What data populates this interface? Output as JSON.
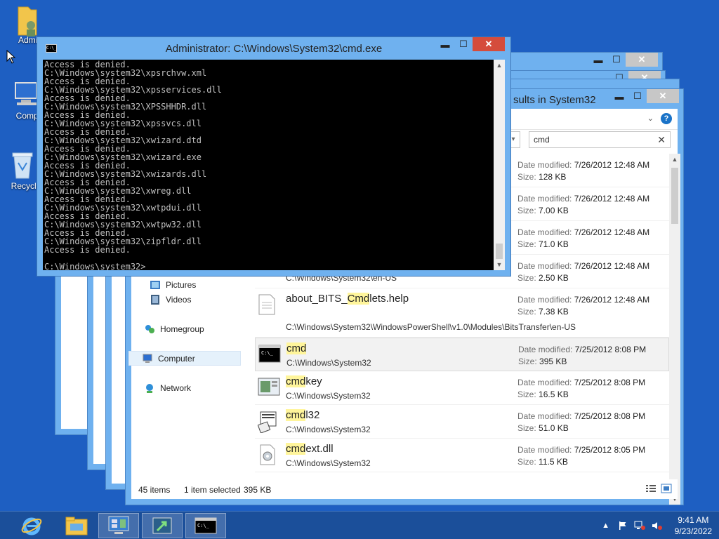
{
  "desktop": {
    "icons": [
      {
        "label": "Admin"
      },
      {
        "label": "Compu"
      },
      {
        "label": "Recycle"
      }
    ]
  },
  "cmd": {
    "title": "Administrator: C:\\Windows\\System32\\cmd.exe",
    "icon_text": "C:\\_",
    "lines": [
      "Access is denied.",
      "C:\\Windows\\system32\\xpsrchvw.xml",
      "Access is denied.",
      "C:\\Windows\\system32\\xpsservices.dll",
      "Access is denied.",
      "C:\\Windows\\system32\\XPSSHHDR.dll",
      "Access is denied.",
      "C:\\Windows\\system32\\xpssvcs.dll",
      "Access is denied.",
      "C:\\Windows\\system32\\xwizard.dtd",
      "Access is denied.",
      "C:\\Windows\\system32\\xwizard.exe",
      "Access is denied.",
      "C:\\Windows\\system32\\xwizards.dll",
      "Access is denied.",
      "C:\\Windows\\system32\\xwreg.dll",
      "Access is denied.",
      "C:\\Windows\\system32\\xwtpdui.dll",
      "Access is denied.",
      "C:\\Windows\\system32\\xwtpw32.dll",
      "Access is denied.",
      "C:\\Windows\\system32\\zipfldr.dll",
      "Access is denied.",
      "",
      "C:\\Windows\\system32>_"
    ]
  },
  "explorer": {
    "title": "sults in System32",
    "search": {
      "value": "cmd"
    },
    "nav": [
      {
        "label": "Pictures",
        "icon": "pictures-icon"
      },
      {
        "label": "Videos",
        "icon": "videos-icon"
      },
      {
        "label": "Homegroup",
        "icon": "homegroup-icon"
      },
      {
        "label": "Computer",
        "icon": "computer-icon"
      },
      {
        "label": "Network",
        "icon": "network-icon"
      }
    ],
    "date_label": "Date modified:",
    "size_label": "Size:",
    "results": [
      {
        "date": "7/26/2012 12:48 AM",
        "size": "128 KB"
      },
      {
        "date": "7/26/2012 12:48 AM",
        "size": "7.00 KB"
      },
      {
        "date": "7/26/2012 12:48 AM",
        "size": "71.0 KB"
      },
      {
        "path": "C:\\Windows\\System32\\en-US",
        "date": "7/26/2012 12:48 AM",
        "size": "2.50 KB"
      },
      {
        "name_pre": "about_BITS_",
        "name_hl": "Cmd",
        "name_post": "lets.help",
        "path": "C:\\Windows\\System32\\WindowsPowerShell\\v1.0\\Modules\\BitsTransfer\\en-US",
        "date": "7/26/2012 12:48 AM",
        "size": "7.38 KB"
      },
      {
        "name_pre": "",
        "name_hl": "cmd",
        "name_post": "",
        "path": "C:\\Windows\\System32",
        "date": "7/25/2012 8:08 PM",
        "size": "395 KB"
      },
      {
        "name_pre": "",
        "name_hl": "cmd",
        "name_post": "key",
        "path": "C:\\Windows\\System32",
        "date": "7/25/2012 8:08 PM",
        "size": "16.5 KB"
      },
      {
        "name_pre": "",
        "name_hl": "cmd",
        "name_post": "l32",
        "path": "C:\\Windows\\System32",
        "date": "7/25/2012 8:08 PM",
        "size": "51.0 KB"
      },
      {
        "name_pre": "",
        "name_hl": "cmd",
        "name_post": "ext.dll",
        "path": "C:\\Windows\\System32",
        "date": "7/25/2012 8:05 PM",
        "size": "11.5 KB"
      }
    ],
    "status": {
      "items": "45 items",
      "selected": "1 item selected",
      "size": "395 KB"
    }
  },
  "taskbar": {
    "clock_time": "9:41 AM",
    "clock_date": "9/23/2022"
  },
  "colors": {
    "desktop": "#1e5fc2",
    "window_frame": "#6fb1ef",
    "close_red": "#d54c3c",
    "highlight": "#fff59b"
  }
}
